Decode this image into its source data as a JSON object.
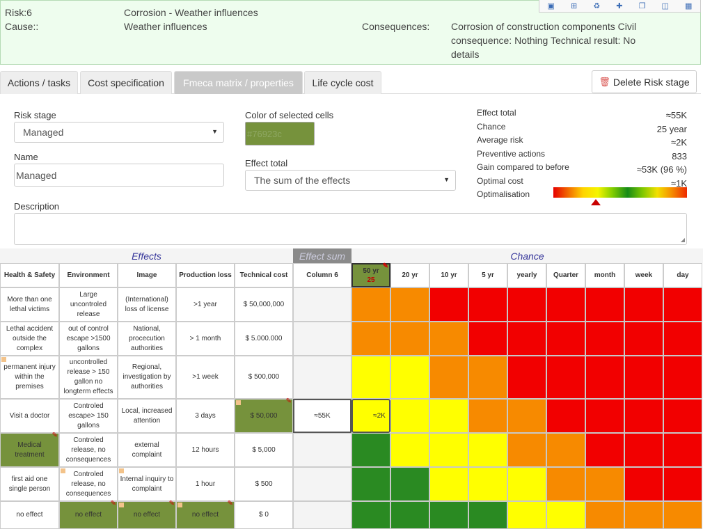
{
  "risk": {
    "risk_label": "Risk:6",
    "risk_title": "Corrosion - Weather influences",
    "cause_label": "Cause::",
    "cause_value": "Weather influences",
    "consequences_label": "Consequences:",
    "consequences_value": "Corrosion of construction components Civil consequence: Nothing Technical result: No details",
    "toolbar_icons": [
      "share-icon",
      "add-box-icon",
      "recycle-icon",
      "plus-icon",
      "copy-icon",
      "trash-icon",
      "save-icon"
    ]
  },
  "tabs": [
    {
      "label": "Actions / tasks",
      "active": false
    },
    {
      "label": "Cost specification",
      "active": false
    },
    {
      "label": "Fmeca matrix / properties",
      "active": true
    },
    {
      "label": "Life cycle cost",
      "active": false
    }
  ],
  "delete_button": "Delete Risk stage",
  "form": {
    "risk_stage_label": "Risk stage",
    "risk_stage_value": "Managed",
    "name_label": "Name",
    "name_value": "Managed",
    "color_label": "Color of selected cells",
    "color_value": "#76923c",
    "effect_total_label": "Effect total",
    "effect_total_value": "The sum of the effects",
    "description_label": "Description",
    "description_value": ""
  },
  "stats": [
    {
      "label": "Effect total",
      "value": "≈55K"
    },
    {
      "label": "Chance",
      "value": "25 year"
    },
    {
      "label": "Average risk",
      "value": "≈2K"
    },
    {
      "label": "Preventive actions",
      "value": "833"
    },
    {
      "label": "Gain compared to before",
      "value": "≈53K (96 %)"
    },
    {
      "label": "Optimal cost",
      "value": "≈1K"
    },
    {
      "label": "Optimalisation",
      "value": ""
    }
  ],
  "optimalisation_level": 0.32,
  "matrix": {
    "group_effects": "Effects",
    "group_effect_sum": "Effect sum",
    "group_chance": "Chance",
    "effect_headers": [
      "Health & Safety",
      "Environment",
      "Image",
      "Production loss",
      "Technical cost",
      "Column 6"
    ],
    "chance_headers": [
      "50 yr",
      "20 yr",
      "10 yr",
      "5 yr",
      "yearly",
      "Quarter",
      "month",
      "week",
      "day"
    ],
    "selected_chance_sub": "25",
    "rows": [
      {
        "cells": [
          "More than one lethal victims",
          "Large uncontroled release",
          "(International) loss of license",
          ">1 year",
          "$ 50,000,000",
          ""
        ],
        "colors": [
          "orange",
          "orange",
          "red",
          "red",
          "red",
          "red",
          "red",
          "red",
          "red"
        ]
      },
      {
        "cells": [
          "Lethal accident outside the complex",
          "out of control escape >1500 gallons",
          "National, procecution authorities",
          "> 1 month",
          "$ 5.000.000",
          ""
        ],
        "colors": [
          "orange",
          "orange",
          "orange",
          "red",
          "red",
          "red",
          "red",
          "red",
          "red"
        ]
      },
      {
        "cells": [
          "permanent injury within the premises",
          "uncontrolled release > 150 gallon no longterm effects",
          "Regional, investigation by authorities",
          ">1 week",
          "$ 500,000",
          ""
        ],
        "colors": [
          "yellow",
          "yellow",
          "orange",
          "orange",
          "red",
          "red",
          "red",
          "red",
          "red"
        ]
      },
      {
        "cells": [
          "Visit a doctor",
          "Controled escape> 150 gallons",
          "Local, increased attention",
          "3 days",
          "$ 50,000",
          "≈55K"
        ],
        "colors": [
          "yellow",
          "yellow",
          "yellow",
          "orange",
          "orange",
          "red",
          "red",
          "red",
          "red"
        ],
        "chance_value": "≈2K"
      },
      {
        "cells": [
          "Medical treatment",
          "Controled release, no consequences",
          "external complaint",
          "12 hours",
          "$ 5,000",
          ""
        ],
        "colors": [
          "green",
          "yellow",
          "yellow",
          "yellow",
          "orange",
          "orange",
          "red",
          "red",
          "red"
        ]
      },
      {
        "cells": [
          "first aid one single person",
          "Controled release, no consequences",
          "Internal inquiry to complaint",
          "1 hour",
          "$ 500",
          ""
        ],
        "colors": [
          "green",
          "green",
          "yellow",
          "yellow",
          "yellow",
          "orange",
          "orange",
          "red",
          "red"
        ]
      },
      {
        "cells": [
          "no effect",
          "no effect",
          "no effect",
          "no effect",
          "$ 0",
          ""
        ],
        "colors": [
          "green",
          "green",
          "green",
          "green",
          "yellow",
          "yellow",
          "orange",
          "orange",
          "orange"
        ]
      }
    ],
    "palette": {
      "red": "#f20000",
      "orange": "#f78a00",
      "yellow": "#ffff00",
      "green": "#2a8a22",
      "selected": "#76923c"
    }
  }
}
